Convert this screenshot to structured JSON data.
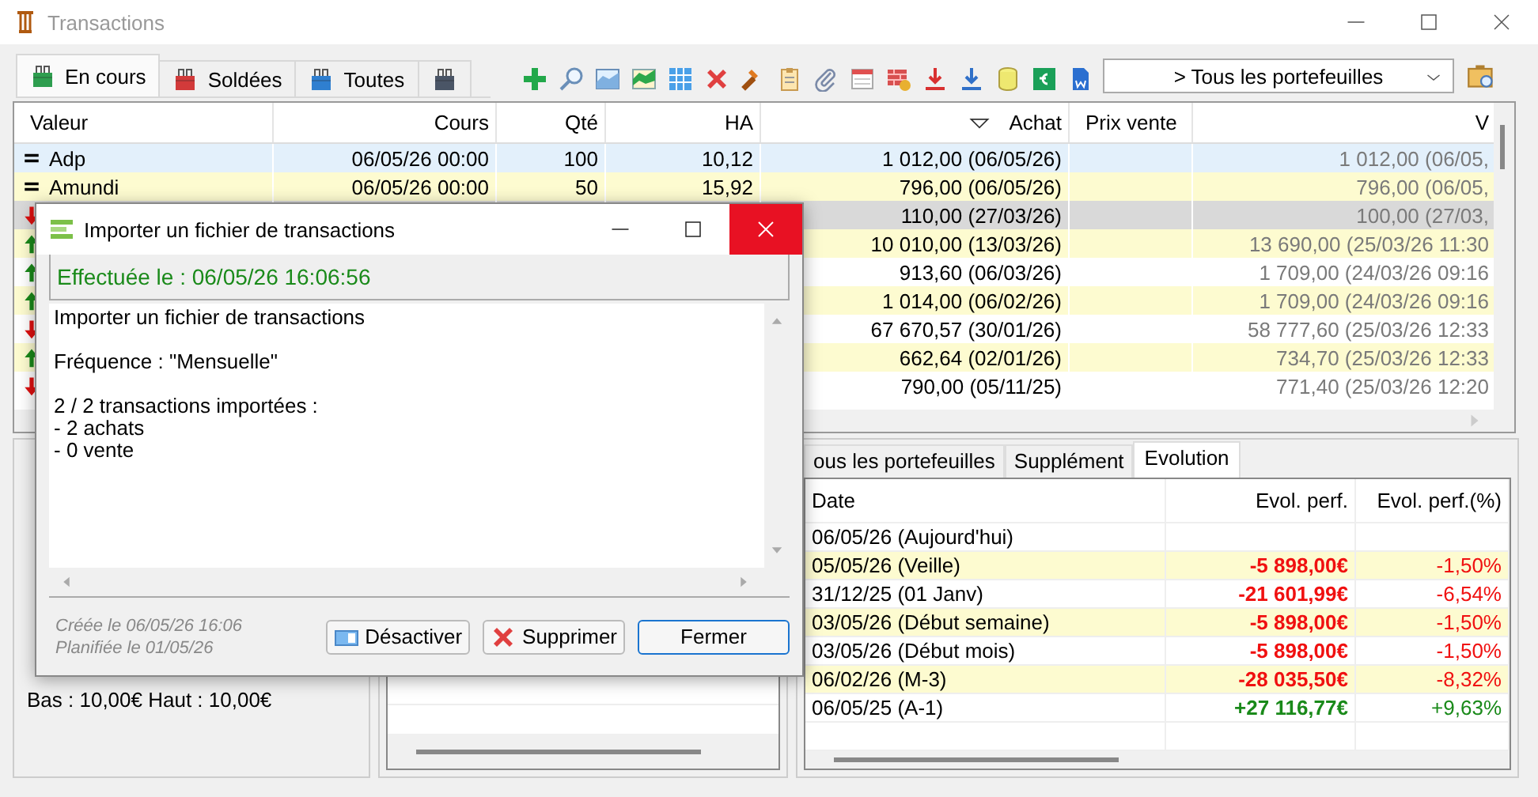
{
  "window": {
    "title": "Transactions"
  },
  "tabs": [
    {
      "label": "En cours",
      "selected": true,
      "color": "#2e9e4f"
    },
    {
      "label": "Soldées",
      "selected": false,
      "color": "#d23a3a"
    },
    {
      "label": "Toutes",
      "selected": false,
      "color": "#2f7fd0"
    },
    {
      "selected": false,
      "color": "#4a5566"
    }
  ],
  "portfolio_select": {
    "value": "> Tous les portefeuilles"
  },
  "table": {
    "columns": [
      "Valeur",
      "Cours",
      "Qté",
      "HA",
      "Achat",
      "Prix vente",
      "V"
    ],
    "rows": [
      {
        "kind": "equal",
        "highlighted": true,
        "selected": false,
        "cells": [
          "Adp",
          "06/05/26 00:00",
          "100",
          "10,12",
          "1 012,00 (06/05/26)",
          null,
          "1 012,00 (06/05,"
        ]
      },
      {
        "kind": "equal",
        "highlighted": false,
        "selected": false,
        "cells": [
          "Amundi",
          "06/05/26 00:00",
          "50",
          "15,92",
          "796,00 (06/05/26)",
          null,
          "796,00 (06/05,"
        ]
      },
      {
        "kind": "down",
        "highlighted": false,
        "selected": true,
        "cells": [
          null,
          null,
          null,
          null,
          "110,00 (27/03/26)",
          null,
          "100,00 (27/03,"
        ]
      },
      {
        "kind": "up",
        "highlighted": false,
        "selected": false,
        "cells": [
          null,
          null,
          null,
          null,
          "10 010,00 (13/03/26)",
          null,
          "13 690,00 (25/03/26 11:30"
        ]
      },
      {
        "kind": "up",
        "highlighted": false,
        "selected": false,
        "cells": [
          null,
          null,
          null,
          null,
          "913,60 (06/03/26)",
          null,
          "1 709,00 (24/03/26 09:16"
        ]
      },
      {
        "kind": "up",
        "highlighted": false,
        "selected": false,
        "cells": [
          null,
          null,
          null,
          null,
          "1 014,00 (06/02/26)",
          null,
          "1 709,00 (24/03/26 09:16"
        ]
      },
      {
        "kind": "down",
        "highlighted": false,
        "selected": false,
        "cells": [
          null,
          null,
          null,
          null,
          "67 670,57 (30/01/26)",
          null,
          "58 777,60 (25/03/26 12:33"
        ]
      },
      {
        "kind": "up",
        "highlighted": false,
        "selected": false,
        "cells": [
          null,
          null,
          null,
          null,
          "662,64 (02/01/26)",
          null,
          "734,70 (25/03/26 12:33"
        ]
      },
      {
        "kind": "down",
        "highlighted": false,
        "selected": false,
        "cells": [
          null,
          null,
          null,
          null,
          "790,00 (05/11/25)",
          null,
          "771,40 (25/03/26 12:20"
        ]
      }
    ]
  },
  "left_panel": {
    "lines": [
      "Bas : 10,00€ Haut : 10,00€"
    ]
  },
  "evolution": {
    "tabs": [
      {
        "label": "ous les portefeuilles",
        "selected": false
      },
      {
        "label": "Supplément",
        "selected": false
      },
      {
        "label": "Evolution",
        "selected": true
      }
    ],
    "columns": [
      "Date",
      "Evol. perf.",
      "Evol. perf.(%)"
    ],
    "rows": [
      {
        "date": "06/05/26 (Aujourd'hui)",
        "kind": "base"
      },
      {
        "date": "05/05/26 (Veille)",
        "perf": "-5 898,00€",
        "percent": "-1,50%",
        "kind": "loss"
      },
      {
        "date": "31/12/25 (01 Janv)",
        "perf": "-21 601,99€",
        "percent": "-6,54%",
        "kind": "loss"
      },
      {
        "date": "03/05/26 (Début semaine)",
        "perf": "-5 898,00€",
        "percent": "-1,50%",
        "kind": "loss"
      },
      {
        "date": "03/05/26 (Début mois)",
        "perf": "-5 898,00€",
        "percent": "-1,50%",
        "kind": "loss"
      },
      {
        "date": "06/02/26 (M-3)",
        "perf": "-28 035,50€",
        "percent": "-8,32%",
        "kind": "loss"
      },
      {
        "date": "06/05/25 (A-1)",
        "perf": "+27 116,77€",
        "percent": "+9,63%",
        "kind": "gain"
      }
    ]
  },
  "dialog": {
    "title": "Importer un fichier de transactions",
    "status": "Effectuée le : 06/05/26 16:06:56",
    "message": [
      [
        "Importer un fichier de transactions"
      ],
      [
        "Fréquence : \"Mensuelle\""
      ],
      [
        "2 / 2 transactions importées :",
        "- 2 achats",
        "- 0 vente"
      ]
    ],
    "created": "Créée le 06/05/26 16:06",
    "scheduled": "Planifiée le 01/05/26",
    "buttons": [
      {
        "label": "Désactiver",
        "kind": "toggle"
      },
      {
        "label": "Supprimer",
        "kind": "delete"
      },
      {
        "label": "Fermer",
        "kind": "default"
      }
    ]
  }
}
